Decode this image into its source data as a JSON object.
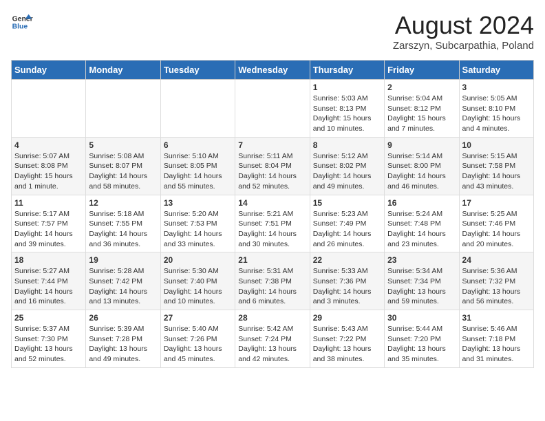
{
  "header": {
    "logo_general": "General",
    "logo_blue": "Blue",
    "month_title": "August 2024",
    "location": "Zarszyn, Subcarpathia, Poland"
  },
  "weekdays": [
    "Sunday",
    "Monday",
    "Tuesday",
    "Wednesday",
    "Thursday",
    "Friday",
    "Saturday"
  ],
  "weeks": [
    [
      {
        "day": "",
        "info": ""
      },
      {
        "day": "",
        "info": ""
      },
      {
        "day": "",
        "info": ""
      },
      {
        "day": "",
        "info": ""
      },
      {
        "day": "1",
        "info": "Sunrise: 5:03 AM\nSunset: 8:13 PM\nDaylight: 15 hours\nand 10 minutes."
      },
      {
        "day": "2",
        "info": "Sunrise: 5:04 AM\nSunset: 8:12 PM\nDaylight: 15 hours\nand 7 minutes."
      },
      {
        "day": "3",
        "info": "Sunrise: 5:05 AM\nSunset: 8:10 PM\nDaylight: 15 hours\nand 4 minutes."
      }
    ],
    [
      {
        "day": "4",
        "info": "Sunrise: 5:07 AM\nSunset: 8:08 PM\nDaylight: 15 hours\nand 1 minute."
      },
      {
        "day": "5",
        "info": "Sunrise: 5:08 AM\nSunset: 8:07 PM\nDaylight: 14 hours\nand 58 minutes."
      },
      {
        "day": "6",
        "info": "Sunrise: 5:10 AM\nSunset: 8:05 PM\nDaylight: 14 hours\nand 55 minutes."
      },
      {
        "day": "7",
        "info": "Sunrise: 5:11 AM\nSunset: 8:04 PM\nDaylight: 14 hours\nand 52 minutes."
      },
      {
        "day": "8",
        "info": "Sunrise: 5:12 AM\nSunset: 8:02 PM\nDaylight: 14 hours\nand 49 minutes."
      },
      {
        "day": "9",
        "info": "Sunrise: 5:14 AM\nSunset: 8:00 PM\nDaylight: 14 hours\nand 46 minutes."
      },
      {
        "day": "10",
        "info": "Sunrise: 5:15 AM\nSunset: 7:58 PM\nDaylight: 14 hours\nand 43 minutes."
      }
    ],
    [
      {
        "day": "11",
        "info": "Sunrise: 5:17 AM\nSunset: 7:57 PM\nDaylight: 14 hours\nand 39 minutes."
      },
      {
        "day": "12",
        "info": "Sunrise: 5:18 AM\nSunset: 7:55 PM\nDaylight: 14 hours\nand 36 minutes."
      },
      {
        "day": "13",
        "info": "Sunrise: 5:20 AM\nSunset: 7:53 PM\nDaylight: 14 hours\nand 33 minutes."
      },
      {
        "day": "14",
        "info": "Sunrise: 5:21 AM\nSunset: 7:51 PM\nDaylight: 14 hours\nand 30 minutes."
      },
      {
        "day": "15",
        "info": "Sunrise: 5:23 AM\nSunset: 7:49 PM\nDaylight: 14 hours\nand 26 minutes."
      },
      {
        "day": "16",
        "info": "Sunrise: 5:24 AM\nSunset: 7:48 PM\nDaylight: 14 hours\nand 23 minutes."
      },
      {
        "day": "17",
        "info": "Sunrise: 5:25 AM\nSunset: 7:46 PM\nDaylight: 14 hours\nand 20 minutes."
      }
    ],
    [
      {
        "day": "18",
        "info": "Sunrise: 5:27 AM\nSunset: 7:44 PM\nDaylight: 14 hours\nand 16 minutes."
      },
      {
        "day": "19",
        "info": "Sunrise: 5:28 AM\nSunset: 7:42 PM\nDaylight: 14 hours\nand 13 minutes."
      },
      {
        "day": "20",
        "info": "Sunrise: 5:30 AM\nSunset: 7:40 PM\nDaylight: 14 hours\nand 10 minutes."
      },
      {
        "day": "21",
        "info": "Sunrise: 5:31 AM\nSunset: 7:38 PM\nDaylight: 14 hours\nand 6 minutes."
      },
      {
        "day": "22",
        "info": "Sunrise: 5:33 AM\nSunset: 7:36 PM\nDaylight: 14 hours\nand 3 minutes."
      },
      {
        "day": "23",
        "info": "Sunrise: 5:34 AM\nSunset: 7:34 PM\nDaylight: 13 hours\nand 59 minutes."
      },
      {
        "day": "24",
        "info": "Sunrise: 5:36 AM\nSunset: 7:32 PM\nDaylight: 13 hours\nand 56 minutes."
      }
    ],
    [
      {
        "day": "25",
        "info": "Sunrise: 5:37 AM\nSunset: 7:30 PM\nDaylight: 13 hours\nand 52 minutes."
      },
      {
        "day": "26",
        "info": "Sunrise: 5:39 AM\nSunset: 7:28 PM\nDaylight: 13 hours\nand 49 minutes."
      },
      {
        "day": "27",
        "info": "Sunrise: 5:40 AM\nSunset: 7:26 PM\nDaylight: 13 hours\nand 45 minutes."
      },
      {
        "day": "28",
        "info": "Sunrise: 5:42 AM\nSunset: 7:24 PM\nDaylight: 13 hours\nand 42 minutes."
      },
      {
        "day": "29",
        "info": "Sunrise: 5:43 AM\nSunset: 7:22 PM\nDaylight: 13 hours\nand 38 minutes."
      },
      {
        "day": "30",
        "info": "Sunrise: 5:44 AM\nSunset: 7:20 PM\nDaylight: 13 hours\nand 35 minutes."
      },
      {
        "day": "31",
        "info": "Sunrise: 5:46 AM\nSunset: 7:18 PM\nDaylight: 13 hours\nand 31 minutes."
      }
    ]
  ]
}
